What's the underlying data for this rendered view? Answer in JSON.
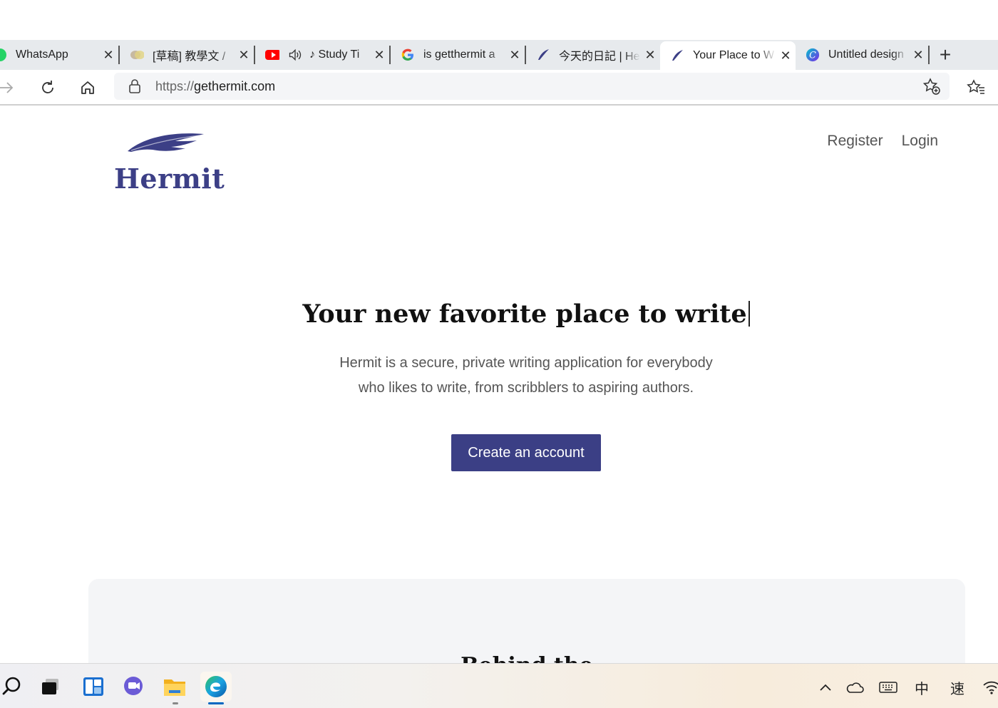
{
  "browser": {
    "tabs": [
      {
        "title": "WhatsApp",
        "icon": "whatsapp-icon"
      },
      {
        "title": "[草稿] 教學文 /",
        "icon": "drafts-icon"
      },
      {
        "title": "♪ Study Ti",
        "icon": "youtube-icon"
      },
      {
        "title": "is getthermit a",
        "icon": "google-icon"
      },
      {
        "title": "今天的日記 | He",
        "icon": "hermit-icon"
      },
      {
        "title": "Your Place to W",
        "icon": "hermit-icon",
        "active": true
      },
      {
        "title": "Untitled design",
        "icon": "canva-icon"
      }
    ],
    "address": {
      "scheme": "https://",
      "host": "gethermit.com"
    }
  },
  "site": {
    "brand": "Hermit",
    "nav": {
      "register": "Register",
      "login": "Login"
    },
    "hero": {
      "title": "Your new favorite place to write",
      "desc_line1": "Hermit is a secure, private writing application for everybody",
      "desc_line2": "who likes to write, from scribblers to aspiring authors.",
      "cta": "Create an account"
    },
    "panel_heading": "Behind the"
  },
  "taskbar": {
    "ime_mode": "中",
    "ime_speed": "速"
  },
  "colors": {
    "brand": "#3c3f86",
    "button": "#3b3f85",
    "tabbar": "#e7eaed"
  }
}
